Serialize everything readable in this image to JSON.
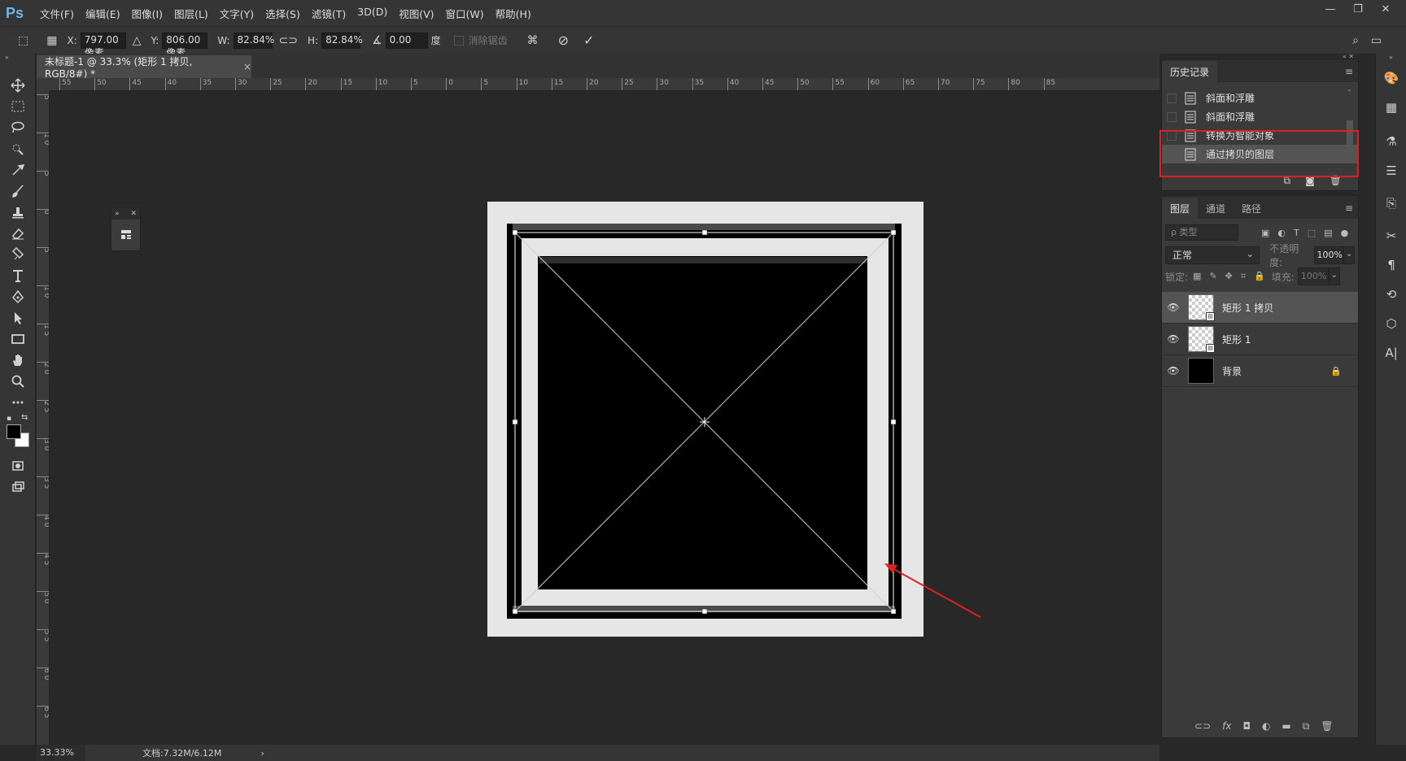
{
  "app": {
    "logo": "Ps"
  },
  "menu": [
    "文件(F)",
    "编辑(E)",
    "图像(I)",
    "图层(L)",
    "文字(Y)",
    "选择(S)",
    "滤镜(T)",
    "3D(D)",
    "视图(V)",
    "窗口(W)",
    "帮助(H)"
  ],
  "window_controls": {
    "minimize": "—",
    "restore": "❐",
    "close": "✕"
  },
  "options": {
    "x_label": "X:",
    "x_value": "797.00 像素",
    "y_label": "Y:",
    "y_value": "806.00 像素",
    "w_label": "W:",
    "w_value": "82.84%",
    "h_label": "H:",
    "h_value": "82.84%",
    "angle_value": "0.00",
    "angle_unit": "度",
    "antialias_label": "消除锯齿"
  },
  "document": {
    "tab_title": "未标题-1 @ 33.3% (矩形 1 拷贝, RGB/8#) *",
    "close": "×"
  },
  "ruler": {
    "h_labels": [
      "55",
      "50",
      "45",
      "40",
      "35",
      "30",
      "25",
      "20",
      "15",
      "10",
      "5",
      "0",
      "5",
      "10",
      "15",
      "20",
      "25",
      "30",
      "35",
      "40",
      "45",
      "50",
      "55",
      "60",
      "65",
      "70",
      "75",
      "80",
      "85"
    ],
    "v_labels": [
      "5",
      "1\n0",
      "5",
      "0",
      "5",
      "1\n0",
      "1\n5",
      "2\n0",
      "2\n5",
      "3\n0",
      "3\n5",
      "4\n0",
      "4\n5",
      "5\n0",
      "5\n5",
      "6\n0",
      "6\n5"
    ]
  },
  "status": {
    "zoom": "33.33%",
    "doc_size": "文档:7.32M/6.12M",
    "arrow": "›"
  },
  "history": {
    "tab_label": "历史记录",
    "items": [
      {
        "label": "斜面和浮雕",
        "selected": false
      },
      {
        "label": "斜面和浮雕",
        "selected": false
      },
      {
        "label": "转换为智能对象",
        "selected": false
      },
      {
        "label": "通过拷贝的图层",
        "selected": true
      }
    ]
  },
  "layers": {
    "tabs": [
      "图层",
      "通道",
      "路径"
    ],
    "filter_placeholder": "ρ 类型",
    "blend_mode": "正常",
    "opacity_label": "不透明度:",
    "opacity_value": "100%",
    "lock_label": "锁定:",
    "fill_label": "填充:",
    "fill_value": "100%",
    "items": [
      {
        "name": "矩形 1 拷贝",
        "thumb": "checker",
        "smart": true,
        "selected": true,
        "locked": false
      },
      {
        "name": "矩形 1",
        "thumb": "checker",
        "smart": true,
        "selected": false,
        "locked": false
      },
      {
        "name": "背景",
        "thumb": "black",
        "smart": false,
        "selected": false,
        "locked": true
      }
    ]
  },
  "colors": {
    "highlight_box": "#e02020",
    "arrow": "#e02020",
    "accent_logo": "#6fb3ea"
  }
}
